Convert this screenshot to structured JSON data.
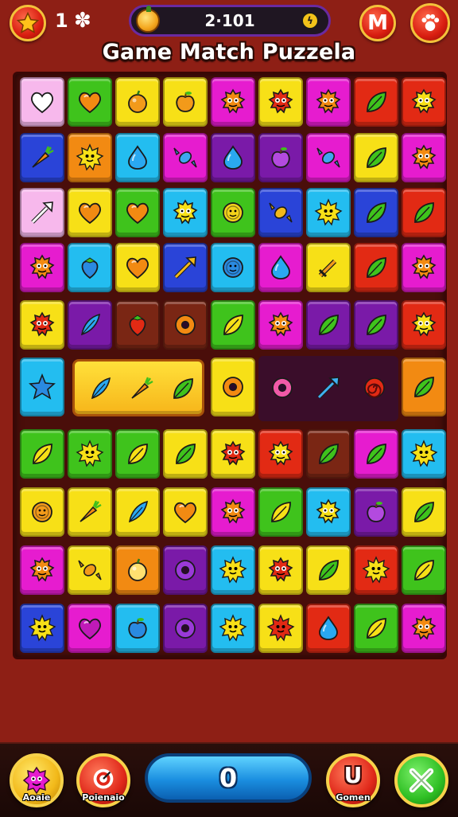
{
  "header": {
    "lives": "1",
    "score": "2·101",
    "title": "Game Match Puzzela",
    "m_button_label": "M"
  },
  "board": {
    "rows": [
      [
        "pink heart",
        "green heart",
        "yellow orange",
        "yellow apple",
        "magenta monster",
        "yellow monster",
        "magenta monster",
        "red leaf",
        "red monster"
      ],
      [
        "blue carrot",
        "orange sun",
        "cyan drop",
        "magenta candy",
        "purple drop",
        "purple apple",
        "magenta candy",
        "yellow leaf",
        "magenta monster"
      ],
      [
        "pink arrow",
        "yellow heart",
        "green heart",
        "cyan monster",
        "green coin",
        "blue candy",
        "cyan sun",
        "blue leaf",
        "red leaf"
      ],
      [
        "magenta monster",
        "cyan strawberry",
        "yellow heart",
        "blue arrow",
        "cyan coin",
        "magenta drop",
        "yellow sword",
        "red leaf",
        "magenta monster"
      ],
      [
        "yellow monster",
        "purple feather",
        "brown strawberry",
        "brown donut",
        "green leaf",
        "magenta monster",
        "purple leaf",
        "purple leaf",
        "red monster"
      ],
      [
        "cyan star",
        "merged",
        "merged",
        "merged",
        "yellow donut",
        "panel",
        "panel",
        "panel",
        "orange leaf"
      ],
      [
        "green leaf",
        "green sun",
        "green leaf",
        "yellow leaf",
        "yellow monster",
        "red monster",
        "brown leaf",
        "magenta leaf",
        "cyan sun"
      ],
      [
        "yellow coin",
        "yellow carrot",
        "yellow feather",
        "yellow heart",
        "magenta monster",
        "green leaf",
        "cyan monster",
        "purple apple",
        "yellow leaf"
      ],
      [
        "magenta monster",
        "yellow candy",
        "orange orange",
        "purple donut",
        "cyan sun",
        "yellow monster",
        "yellow leaf",
        "red sun",
        "green leaf"
      ],
      [
        "blue sun",
        "magenta heart",
        "cyan apple",
        "purple donut",
        "cyan sun",
        "yellow sun",
        "red drop",
        "green leaf",
        "magenta monster"
      ]
    ],
    "merged_items": [
      "blue feather",
      "purple carrot",
      "blue leaf"
    ],
    "panel_items": [
      "pink donut",
      "blue arrow",
      "red swirl"
    ]
  },
  "bottom_bar": {
    "left_label": "Aoaie",
    "second_label": "Poienaio",
    "counter": "0",
    "fourth_label": "Gomen",
    "u_label": "U"
  },
  "colors": {
    "background": "#8e1f15",
    "board": "#4a0e0a",
    "pink": "#f7b8ec",
    "green": "#3fc31c",
    "yellow": "#f7e017",
    "magenta": "#e61ccf",
    "cyan": "#23bdf0",
    "blue": "#2a44d8",
    "purple": "#7a1aa8",
    "red": "#e22a14",
    "orange": "#f28a12",
    "brown": "#7a2614"
  }
}
